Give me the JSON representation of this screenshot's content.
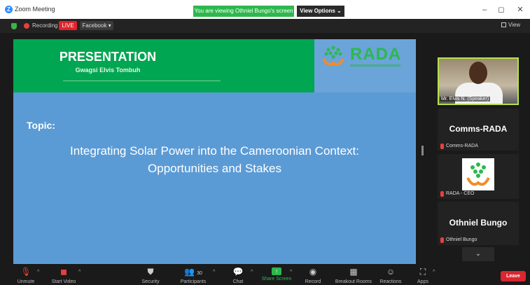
{
  "window": {
    "title": "Zoom Meeting",
    "share_banner": "You are viewing Othniel Bungo's screen",
    "view_options": "View Options ⌄",
    "minimize": "–",
    "maximize": "◻",
    "close": "✕"
  },
  "subbar": {
    "recording": "Recording",
    "live": "LIVE",
    "facebook": "Facebook ▾",
    "view": "View"
  },
  "slide": {
    "title": "PRESENTATION",
    "presenter": "Gwagsi Elvis Tombuh",
    "logo_text": "RADA",
    "topic_label": "Topic:",
    "topic_line1": "Integrating Solar Power into the Cameroonian Context:",
    "topic_line2": "Opportunities and Stakes"
  },
  "participants": [
    {
      "name_label": "Mr. Elvis N. (Speaker)"
    },
    {
      "display": "Comms-RADA",
      "name_label": "Comms-RADA"
    },
    {
      "name_label": "RADA - CEO"
    },
    {
      "display": "Othniel Bungo",
      "name_label": "Othniel Bungo"
    }
  ],
  "toolbar": {
    "unmute": "Unmute",
    "start_video": "Start Video",
    "security": "Security",
    "participants": "Participants",
    "participant_count": "30",
    "chat": "Chat",
    "share_screen": "Share Screen",
    "record": "Record",
    "breakout_rooms": "Breakout Rooms",
    "reactions": "Reactions",
    "apps": "Apps",
    "leave": "Leave"
  },
  "colors": {
    "slide_bg": "#5b9bd5",
    "slide_header": "#00a651",
    "share_green": "#2db84d",
    "leave_red": "#d9262f",
    "live_red": "#e0232b"
  }
}
